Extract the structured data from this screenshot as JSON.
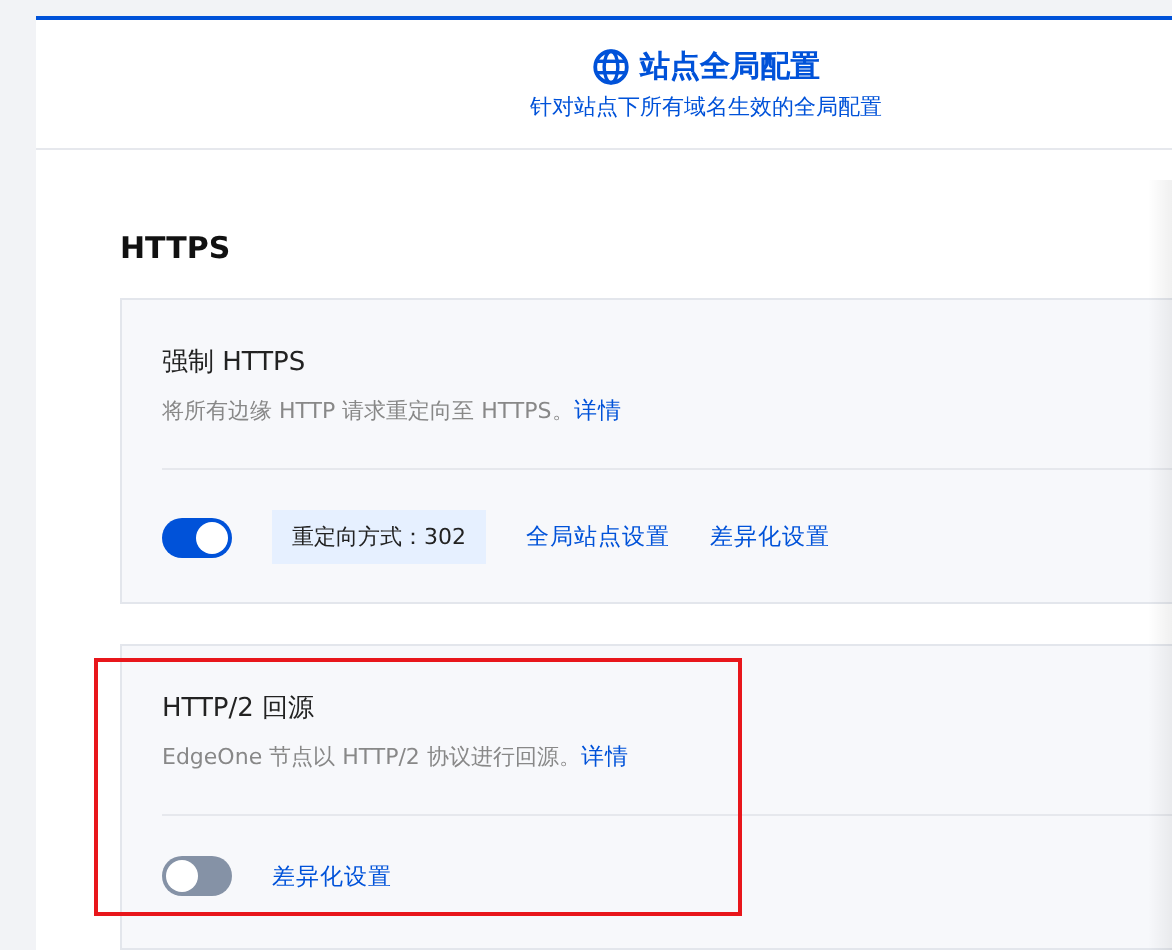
{
  "header": {
    "title": "站点全局配置",
    "subtitle": "针对站点下所有域名生效的全局配置"
  },
  "section": {
    "title": "HTTPS"
  },
  "cards": [
    {
      "title": "强制 HTTPS",
      "description": "将所有边缘 HTTP 请求重定向至 HTTPS。",
      "detail_link": "详情",
      "on": true,
      "tag": "重定向方式：302",
      "links": [
        "全局站点设置",
        "差异化设置"
      ],
      "highlighted": false
    },
    {
      "title": "HTTP/2 回源",
      "description": "EdgeOne 节点以 HTTP/2 协议进行回源。",
      "detail_link": "详情",
      "on": false,
      "links": [
        "差异化设置"
      ],
      "highlighted": true
    }
  ]
}
